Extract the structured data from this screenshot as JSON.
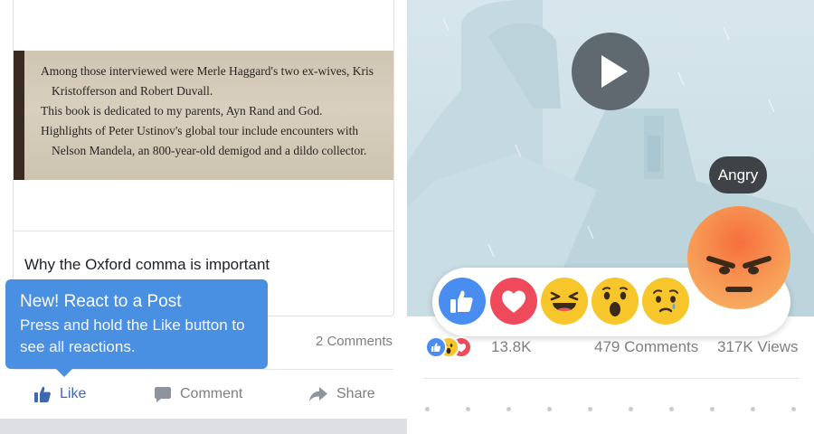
{
  "left_panel": {
    "post_image": {
      "book_lines": [
        "Among those interviewed were Merle Haggard's two ex-wives, Kris",
        "Kristofferson and Robert Duvall.",
        "This book is dedicated to my parents, Ayn Rand and God.",
        "Highlights of Peter Ustinov's global tour include encounters with",
        "Nelson Mandela, an 800-year-old demigod and a dildo collector."
      ]
    },
    "post_title": "Why the Oxford comma is important",
    "tooltip": {
      "title": "New! React to a Post",
      "body": "Press and hold the Like button to see all reactions."
    },
    "comments_count": "2 Comments",
    "actions": {
      "like": "Like",
      "comment": "Comment",
      "share": "Share"
    },
    "colors": {
      "tooltip_bg": "#4a90e2",
      "like_blue": "#4267b2",
      "muted_text": "#7f7f7f"
    }
  },
  "right_panel": {
    "video": {
      "play_icon": "play-icon"
    },
    "hover_label": "Angry",
    "reactions": [
      {
        "name": "like",
        "icon": "thumbs-up-icon",
        "color": "#4a8df1"
      },
      {
        "name": "love",
        "icon": "heart-icon",
        "color": "#ef4a5c"
      },
      {
        "name": "haha",
        "icon": "laughing-face-icon",
        "color": "#f7c62b"
      },
      {
        "name": "wow",
        "icon": "surprised-face-icon",
        "color": "#f7c62b"
      },
      {
        "name": "sad",
        "icon": "sad-face-icon",
        "color": "#f7c62b"
      },
      {
        "name": "angry",
        "icon": "angry-face-icon",
        "color": "#f66f3c"
      }
    ],
    "stats": {
      "reaction_count": "13.8K",
      "comments": "479 Comments",
      "views": "317K Views"
    }
  }
}
